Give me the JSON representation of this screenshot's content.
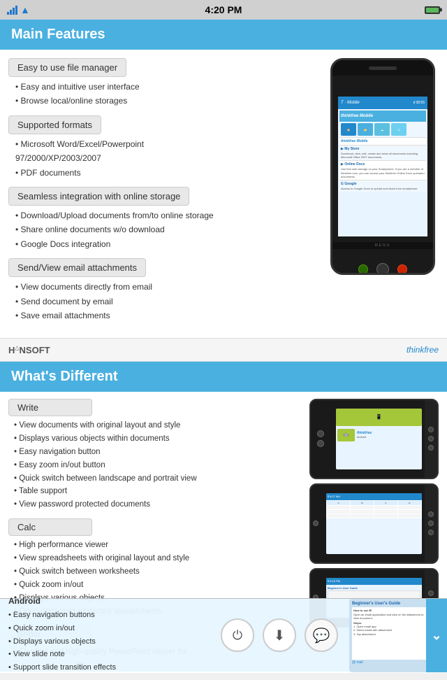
{
  "statusBar": {
    "time": "4:20 PM"
  },
  "mainFeatures": {
    "sectionTitle": "Main Features",
    "groups": [
      {
        "label": "Easy to use file manager",
        "items": [
          "• Easy and intuitive user interface",
          "• Browse local/online storages"
        ]
      },
      {
        "label": "Supported formats",
        "items": [
          "• Microsoft Word/Excel/Powerpoint",
          "  97/2000/XP/2003/2007",
          "• PDF documents"
        ]
      },
      {
        "label": "Seamless integration with online storage",
        "items": [
          "• Download/Upload documents from/to online storage",
          "• Share online documents w/o download",
          "• Google Docs integration"
        ]
      },
      {
        "label": "Send/View email attachments",
        "items": [
          "• View documents directly from email",
          "• Send document by email",
          "• Save email attachments"
        ]
      }
    ]
  },
  "branding": {
    "left": "HANSOFT",
    "right": "thinkfree"
  },
  "whatsDifferent": {
    "sectionTitle": "What's Different",
    "groups": [
      {
        "label": "Write",
        "items": [
          "• View documents with original layout and style",
          "• Displays various objects within documents",
          "• Easy navigation button",
          "• Easy zoom in/out button",
          "• Quick switch between landscape and portrait view",
          "• Table support",
          "• View password protected documents"
        ]
      },
      {
        "label": "Calc",
        "items": [
          "• High performance viewer",
          "• View spreadsheets with original layout and style",
          "• Quick switch between worksheets",
          "• Quick zoom in/out",
          "• Displsys various objects",
          "• Open password-protected spreadsheets"
        ]
      },
      {
        "label": "Show",
        "items": [
          "• The first and high-quality PowerPoint viewer for..."
        ]
      }
    ]
  },
  "bottomOverlay": {
    "platform": "Android",
    "items": [
      "• Easy navigation buttons",
      "• Quick zoom in/out",
      "• Displays various objects",
      "• View slide note",
      "• Support slide transition effects"
    ]
  }
}
